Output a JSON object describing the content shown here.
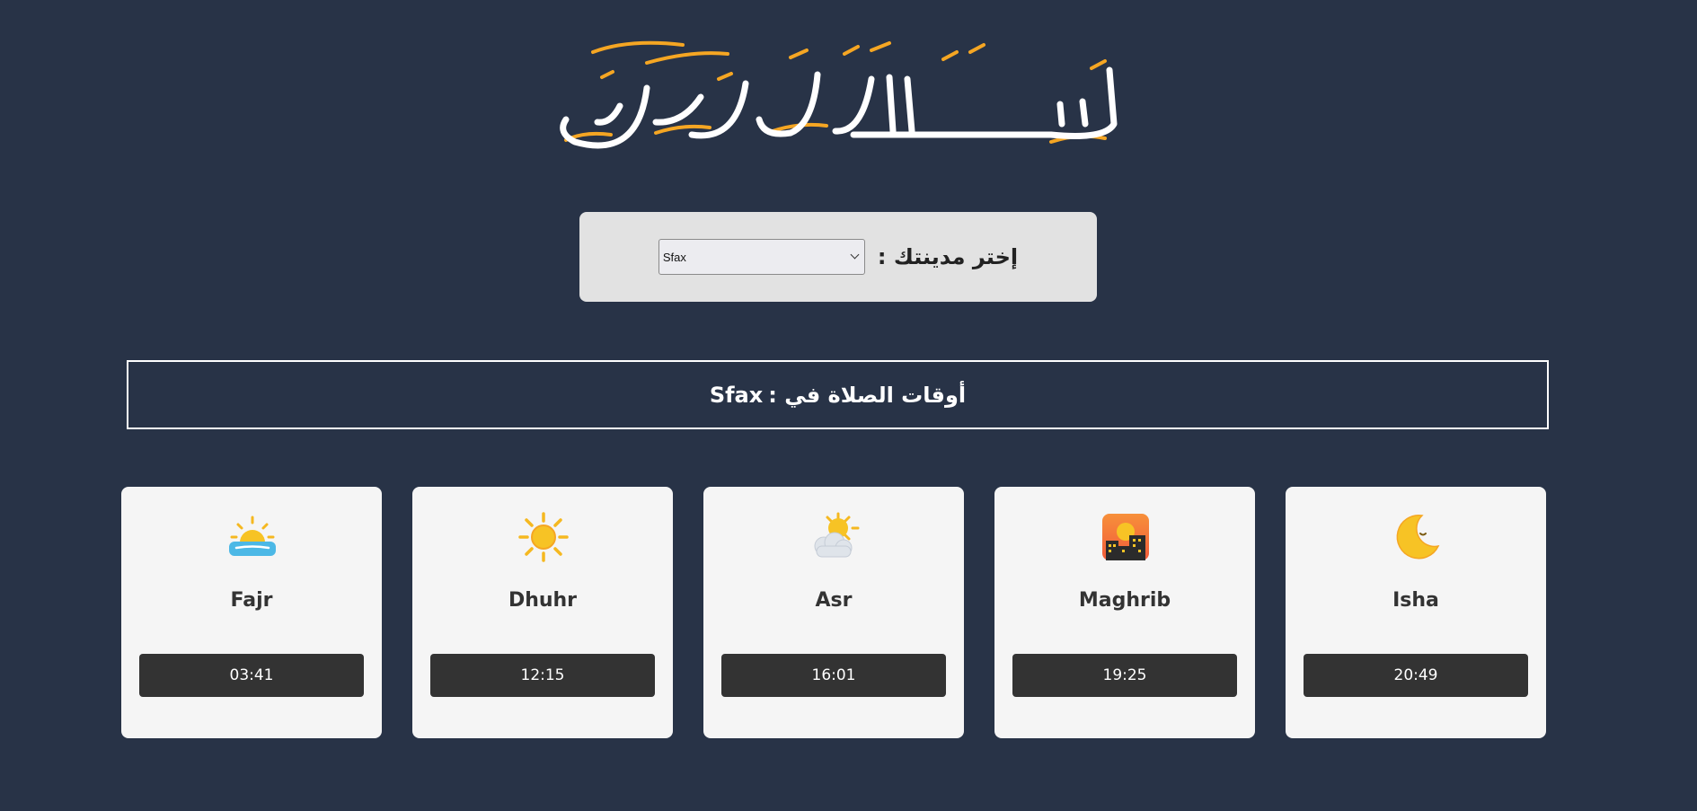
{
  "header": {
    "calligraphy_text": "بِسْمِ ٱللَّٰهِ ٱلرَّحْمَٰنِ ٱلرَّحِيمِ"
  },
  "city_selector": {
    "label": "إختر مدينتك :",
    "selected": "Sfax"
  },
  "title": {
    "prefix": "أوقات الصلاة في :",
    "city": "Sfax"
  },
  "prayers": [
    {
      "name": "Fajr",
      "time": "03:41",
      "icon": "sunrise-icon"
    },
    {
      "name": "Dhuhr",
      "time": "12:15",
      "icon": "sun-icon"
    },
    {
      "name": "Asr",
      "time": "16:01",
      "icon": "sun-behind-cloud-icon"
    },
    {
      "name": "Maghrib",
      "time": "19:25",
      "icon": "sunset-city-icon"
    },
    {
      "name": "Isha",
      "time": "20:49",
      "icon": "crescent-moon-icon"
    }
  ],
  "colors": {
    "background": "#283347",
    "panel": "#e2e2e2",
    "card": "#f5f5f5",
    "time_badge": "#333333",
    "accent_gold": "#f5a623"
  }
}
